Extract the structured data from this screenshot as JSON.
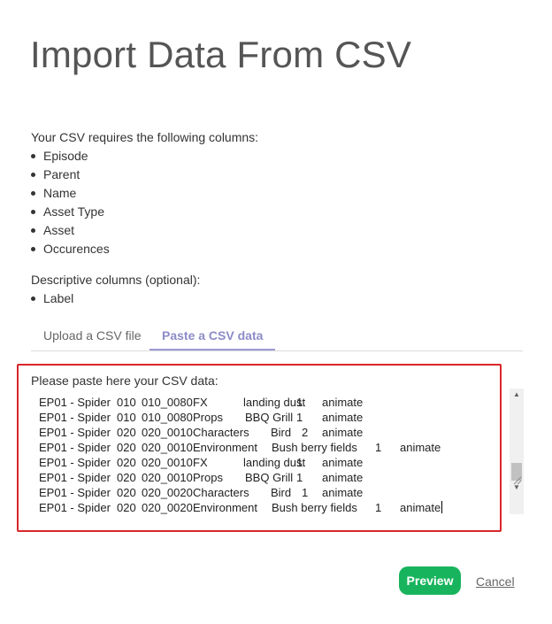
{
  "page": {
    "title": "Import Data From CSV"
  },
  "requirements": {
    "intro": "Your CSV requires the following columns:",
    "columns": [
      "Episode",
      "Parent",
      "Name",
      "Asset Type",
      "Asset",
      "Occurences"
    ]
  },
  "descriptive": {
    "intro": "Descriptive columns (optional):",
    "columns": [
      "Label"
    ]
  },
  "tabs": [
    {
      "label": "Upload a CSV file",
      "active": false
    },
    {
      "label": "Paste a CSV data",
      "active": true
    }
  ],
  "paste": {
    "label": "Please paste here your CSV data:",
    "rows": [
      {
        "ep": "EP01 - Spider",
        "seq": "010",
        "shot": "010_0080",
        "type": "FX",
        "asset": "landing dust",
        "occ": "1",
        "label": "animate"
      },
      {
        "ep": "EP01 - Spider",
        "seq": "010",
        "shot": "010_0080",
        "type": "Props",
        "asset": "BBQ Grill",
        "occ": "1",
        "label": "animate"
      },
      {
        "ep": "EP01 - Spider",
        "seq": "020",
        "shot": "020_0010",
        "type": "Characters",
        "asset": "Bird",
        "occ": "2",
        "label": "animate"
      },
      {
        "ep": "EP01 - Spider",
        "seq": "020",
        "shot": "020_0010",
        "type": "Environment",
        "asset": "Bush berry fields",
        "occ": "1",
        "label": "animate"
      },
      {
        "ep": "EP01 - Spider",
        "seq": "020",
        "shot": "020_0010",
        "type": "FX",
        "asset": "landing dust",
        "occ": "1",
        "label": "animate"
      },
      {
        "ep": "EP01 - Spider",
        "seq": "020",
        "shot": "020_0010",
        "type": "Props",
        "asset": "BBQ Grill",
        "occ": "1",
        "label": "animate"
      },
      {
        "ep": "EP01 - Spider",
        "seq": "020",
        "shot": "020_0020",
        "type": "Characters",
        "asset": "Bird",
        "occ": "1",
        "label": "animate"
      },
      {
        "ep": "EP01 - Spider",
        "seq": "020",
        "shot": "020_0020",
        "type": "Environment",
        "asset": "Bush berry fields",
        "occ": "1",
        "label": "animate"
      }
    ]
  },
  "actions": {
    "preview_label": "Preview",
    "cancel_label": "Cancel"
  },
  "colors": {
    "accent_tab": "#8c8cc7",
    "preview_button": "#18b45d",
    "highlight_border": "#d9262b"
  },
  "icons": {
    "scroll_up": "scroll-up-arrow-icon",
    "scroll_down": "scroll-down-arrow-icon",
    "resize": "resize-grip-icon"
  }
}
